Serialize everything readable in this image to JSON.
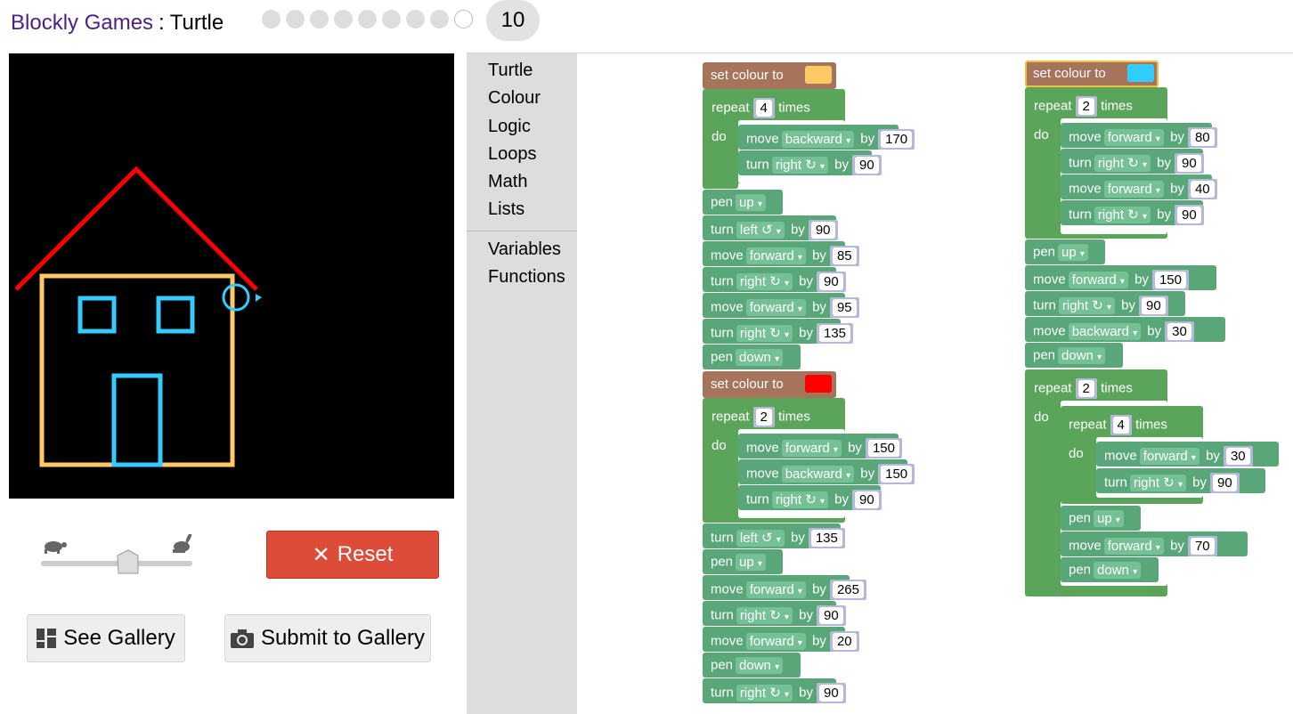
{
  "header": {
    "brand": "Blockly Games",
    "separator": ":",
    "game": "Turtle",
    "level": "10"
  },
  "controls": {
    "reset_label": "Reset",
    "see_gallery_label": "See Gallery",
    "submit_gallery_label": "Submit to Gallery",
    "speed_fraction": 0.5
  },
  "toolbox": {
    "categories": [
      "Turtle",
      "Colour",
      "Logic",
      "Loops",
      "Math",
      "Lists"
    ],
    "extra": [
      "Variables",
      "Functions"
    ]
  },
  "colors": {
    "yellow": "#ffc966",
    "cyan": "#33ccff",
    "red": "#ff0000"
  },
  "blocks": {
    "set_colour": "set colour to",
    "repeat": "repeat",
    "times": "times",
    "do": "do",
    "move": "move",
    "turn": "turn",
    "pen": "pen",
    "by": "by",
    "forward": "forward",
    "backward": "backward",
    "right": "right ↻",
    "left": "left ↺",
    "up": "up",
    "down": "down",
    "vals": {
      "r1": "4",
      "m1": "170",
      "t1": "90",
      "t2": "90",
      "m2": "85",
      "t3": "90",
      "m3": "95",
      "t4": "135",
      "r2": "2",
      "m4": "150",
      "m5": "150",
      "t5": "90",
      "t6": "135",
      "m6": "265",
      "t7": "90",
      "m7": "20",
      "t8": "90",
      "r3": "2",
      "m8": "80",
      "t9": "90",
      "m9": "40",
      "t10": "90",
      "m10": "150",
      "t11": "90",
      "m11": "30",
      "r4": "2",
      "r5": "4",
      "m12": "30",
      "t12": "90",
      "m13": "70"
    }
  }
}
